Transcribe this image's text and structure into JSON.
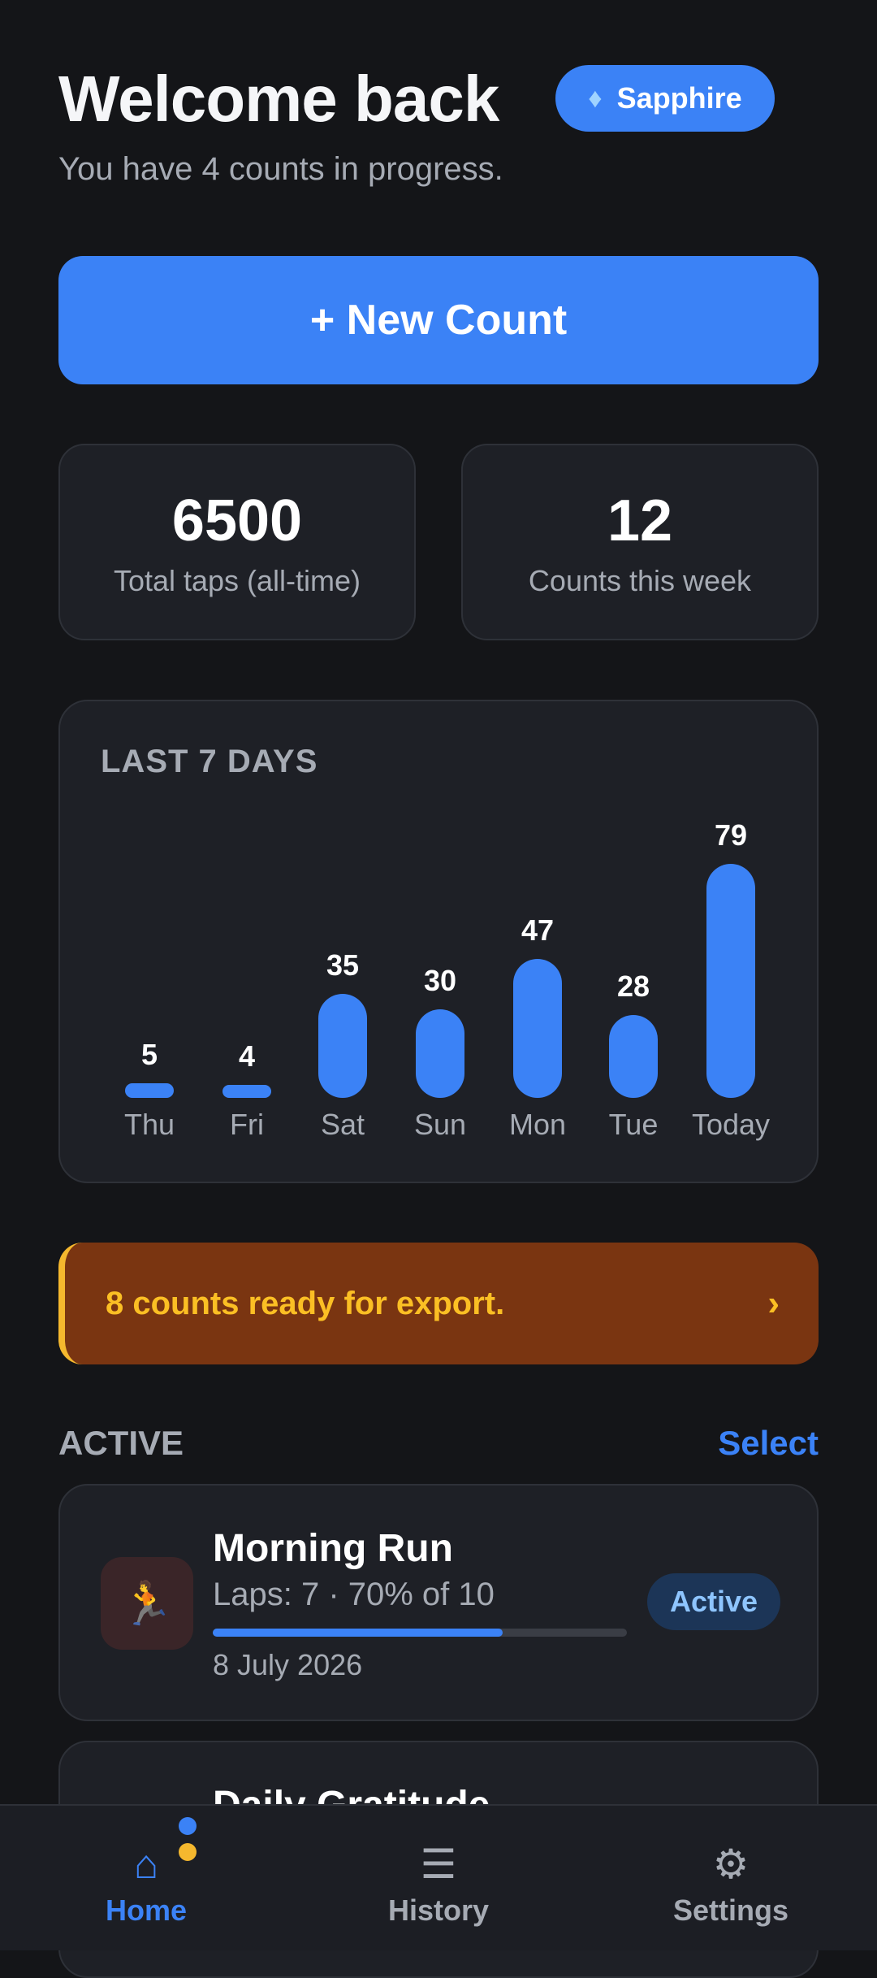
{
  "header": {
    "title": "Welcome back",
    "badge_label": "Sapphire",
    "badge_icon": "gem-icon",
    "subtitle": "You have 4 counts in progress."
  },
  "new_count_button": "+ New Count",
  "stats": [
    {
      "value": "6500",
      "label": "Total taps (all-time)"
    },
    {
      "value": "12",
      "label": "Counts this week"
    }
  ],
  "chart_data": {
    "type": "bar",
    "title": "LAST 7 DAYS",
    "categories": [
      "Thu",
      "Fri",
      "Sat",
      "Sun",
      "Mon",
      "Tue",
      "Today"
    ],
    "values": [
      5,
      4,
      35,
      30,
      47,
      28,
      79
    ],
    "color": "#3b82f6"
  },
  "export_banner": {
    "text": "8 counts ready for export.",
    "chevron": "›"
  },
  "active_section": {
    "label": "ACTIVE",
    "select_label": "Select",
    "items": [
      {
        "name": "Morning Run",
        "emoji": "🏃",
        "meta": "Laps: 7  ·  70% of 10",
        "progress": 0.7,
        "date": "8 July 2026",
        "status": "Active"
      },
      {
        "name": "Daily Gratitude"
      }
    ]
  },
  "tabbar": {
    "tabs": [
      {
        "label": "Home",
        "icon": "home-icon",
        "glyph": "⌂"
      },
      {
        "label": "History",
        "icon": "list-icon",
        "glyph": "☰"
      },
      {
        "label": "Settings",
        "icon": "gear-icon",
        "glyph": "⚙"
      }
    ]
  },
  "colors": {
    "accent": "#3b82f6",
    "background": "#141518",
    "card": "#1e2026",
    "warning": "#fbbf24"
  }
}
